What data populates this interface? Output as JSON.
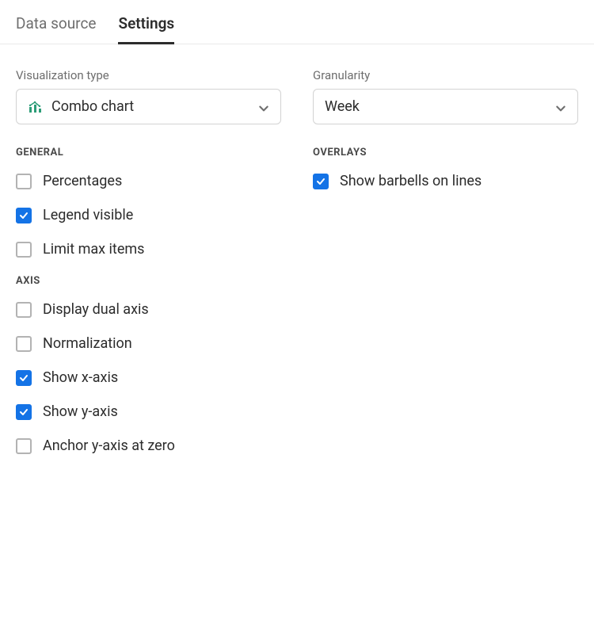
{
  "tabs": {
    "data_source": "Data source",
    "settings": "Settings"
  },
  "left": {
    "viz_type_label": "Visualization type",
    "viz_type_value": "Combo chart",
    "general_title": "GENERAL",
    "percentages_label": "Percentages",
    "legend_visible_label": "Legend visible",
    "limit_max_label": "Limit max items",
    "axis_title": "AXIS",
    "dual_axis_label": "Display dual axis",
    "normalization_label": "Normalization",
    "show_x_label": "Show x-axis",
    "show_y_label": "Show y-axis",
    "anchor_y_label": "Anchor y-axis at zero"
  },
  "right": {
    "granularity_label": "Granularity",
    "granularity_value": "Week",
    "overlays_title": "OVERLAYS",
    "barbells_label": "Show barbells on lines"
  }
}
